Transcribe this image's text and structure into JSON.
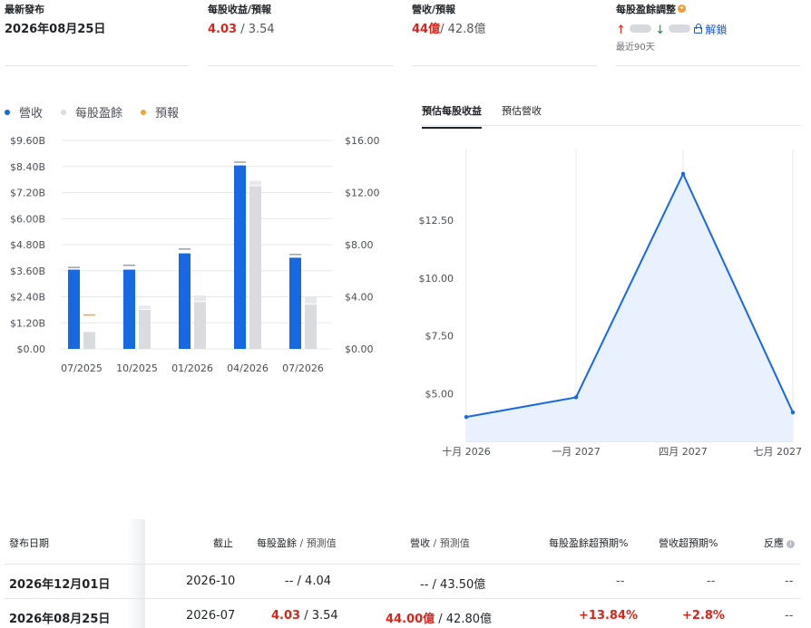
{
  "stats": {
    "latest_release": {
      "label": "最新發布",
      "value": "2026年08月25日"
    },
    "eps": {
      "label": "每股收益/預報",
      "actual": "4.03",
      "separator": " / ",
      "estimate": "3.54"
    },
    "revenue": {
      "label": "營收/預報",
      "actual": "44億",
      "separator": "/ ",
      "estimate": "42.8億"
    },
    "eps_revision": {
      "label": "每股盈餘調整",
      "unlock_label": "解鎖",
      "period": "最近90天"
    }
  },
  "legend": [
    {
      "label": "營收",
      "color": "#1668e3"
    },
    {
      "label": "每股盈餘",
      "color": "#d9dbde"
    },
    {
      "label": "預報",
      "color": "#f0a63a"
    }
  ],
  "tabs": [
    {
      "label": "預估每股收益",
      "active": true
    },
    {
      "label": "預估營收",
      "active": false
    }
  ],
  "chart_data": [
    {
      "type": "bar",
      "categories": [
        "07/2025",
        "10/2025",
        "01/2026",
        "04/2026",
        "07/2026"
      ],
      "left_axis_ticks": [
        "$0.00",
        "$1.20B",
        "$2.40B",
        "$3.60B",
        "$4.80B",
        "$6.00B",
        "$7.20B",
        "$8.40B",
        "$9.60B"
      ],
      "right_axis_ticks": [
        "$0.00",
        "$4.00",
        "$8.00",
        "$12.00",
        "$16.00"
      ],
      "ylim_left": [
        0,
        9.6
      ],
      "ylim_right": [
        0,
        16
      ],
      "series": [
        {
          "name": "營收",
          "axis": "left",
          "values": [
            3.65,
            3.65,
            4.4,
            8.45,
            4.2
          ],
          "estimates": [
            3.75,
            3.85,
            4.6,
            8.6,
            4.35
          ]
        },
        {
          "name": "每股盈餘",
          "axis": "right",
          "values": [
            1.3,
            3.0,
            3.6,
            12.5,
            3.4
          ],
          "estimates": [
            null,
            3.3,
            4.1,
            12.9,
            4.0
          ]
        },
        {
          "name": "預報",
          "axis": "right",
          "values": [
            2.6,
            null,
            null,
            null,
            null
          ]
        }
      ]
    },
    {
      "type": "area",
      "x": [
        "十月 2026",
        "一月 2027",
        "四月 2027",
        "七月 2027"
      ],
      "y": [
        4.0,
        4.85,
        14.5,
        4.2
      ],
      "y_ticks": [
        "$5.00",
        "$7.50",
        "$10.00",
        "$12.50"
      ],
      "ylim": [
        2.95,
        15.55
      ]
    }
  ],
  "table": {
    "headers": {
      "date": "發布日期",
      "period": "截止",
      "eps": "每股盈餘",
      "eps_sep": " / ",
      "eps_est": "預測值",
      "rev": "營收",
      "rev_sep": " / ",
      "rev_est": "預測值",
      "eps_surprise": "每股盈餘超預期%",
      "rev_surprise": "營收超預期%",
      "reaction": "反應"
    },
    "rows": [
      {
        "date": "2026年12月01日",
        "period": "2026-10",
        "eps": "--",
        "eps_sep": " /  ",
        "eps_est": "4.04",
        "rev": "--",
        "rev_sep": " /  ",
        "rev_est": "43.50億",
        "eps_surprise": "--",
        "rev_surprise": "--",
        "reaction": "--"
      },
      {
        "date": "2026年08月25日",
        "period": "2026-07",
        "eps": "4.03",
        "eps_sep": " /  ",
        "eps_est": "3.54",
        "rev": "44.00億",
        "rev_sep": " /  ",
        "rev_est": "42.80億",
        "eps_surprise": "+13.84%",
        "rev_surprise": "+2.8%",
        "reaction": "--"
      }
    ]
  }
}
